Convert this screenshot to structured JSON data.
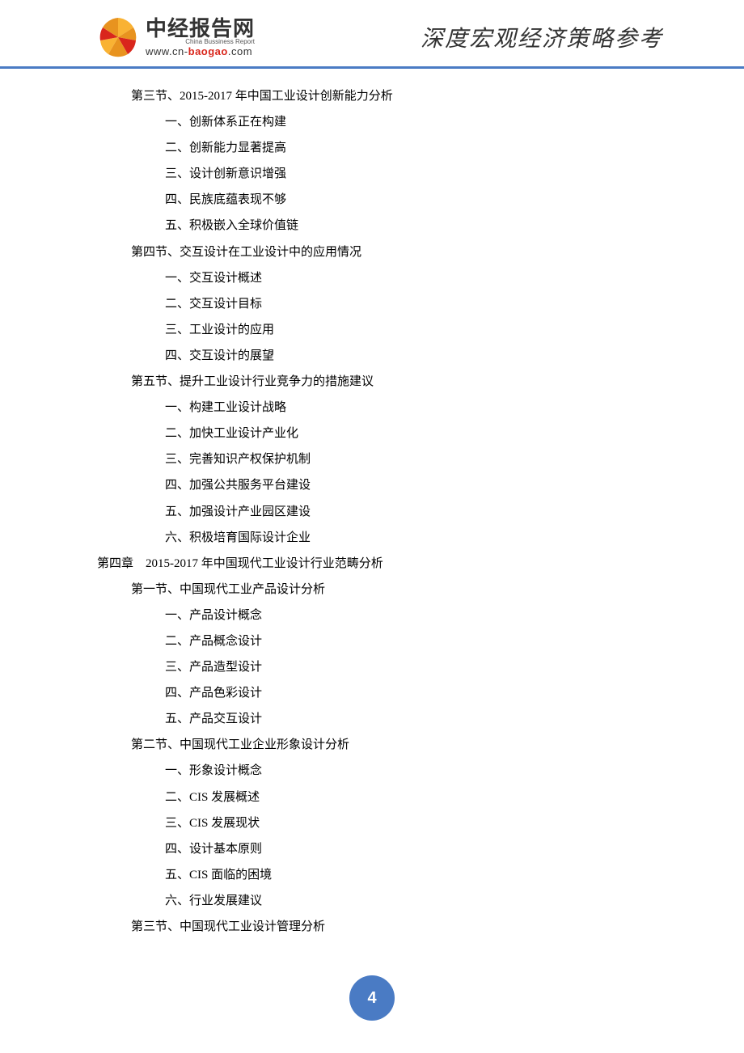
{
  "header": {
    "logo_title": "中经报告网",
    "logo_subtitle": "China Bussiness Report",
    "logo_url_prefix": "www.cn-",
    "logo_url_mid": "baogao",
    "logo_url_suffix": ".com",
    "slogan": "深度宏观经济策略参考"
  },
  "toc": [
    {
      "level": "section",
      "text": "第三节、2015-2017 年中国工业设计创新能力分析"
    },
    {
      "level": "item",
      "text": "一、创新体系正在构建"
    },
    {
      "level": "item",
      "text": "二、创新能力显著提高"
    },
    {
      "level": "item",
      "text": "三、设计创新意识增强"
    },
    {
      "level": "item",
      "text": "四、民族底蕴表现不够"
    },
    {
      "level": "item",
      "text": "五、积极嵌入全球价值链"
    },
    {
      "level": "section",
      "text": "第四节、交互设计在工业设计中的应用情况"
    },
    {
      "level": "item",
      "text": "一、交互设计概述"
    },
    {
      "level": "item",
      "text": "二、交互设计目标"
    },
    {
      "level": "item",
      "text": "三、工业设计的应用"
    },
    {
      "level": "item",
      "text": "四、交互设计的展望"
    },
    {
      "level": "section",
      "text": "第五节、提升工业设计行业竞争力的措施建议"
    },
    {
      "level": "item",
      "text": "一、构建工业设计战略"
    },
    {
      "level": "item",
      "text": "二、加快工业设计产业化"
    },
    {
      "level": "item",
      "text": "三、完善知识产权保护机制"
    },
    {
      "level": "item",
      "text": "四、加强公共服务平台建设"
    },
    {
      "level": "item",
      "text": "五、加强设计产业园区建设"
    },
    {
      "level": "item",
      "text": "六、积极培育国际设计企业"
    },
    {
      "level": "chapter",
      "text": "第四章　2015-2017 年中国现代工业设计行业范畴分析"
    },
    {
      "level": "section",
      "text": "第一节、中国现代工业产品设计分析"
    },
    {
      "level": "item",
      "text": "一、产品设计概念"
    },
    {
      "level": "item",
      "text": "二、产品概念设计"
    },
    {
      "level": "item",
      "text": "三、产品造型设计"
    },
    {
      "level": "item",
      "text": "四、产品色彩设计"
    },
    {
      "level": "item",
      "text": "五、产品交互设计"
    },
    {
      "level": "section",
      "text": "第二节、中国现代工业企业形象设计分析"
    },
    {
      "level": "item",
      "text": "一、形象设计概念"
    },
    {
      "level": "item",
      "text": "二、CIS 发展概述"
    },
    {
      "level": "item",
      "text": "三、CIS 发展现状"
    },
    {
      "level": "item",
      "text": "四、设计基本原则"
    },
    {
      "level": "item",
      "text": "五、CIS 面临的困境"
    },
    {
      "level": "item",
      "text": "六、行业发展建议"
    },
    {
      "level": "section",
      "text": "第三节、中国现代工业设计管理分析"
    }
  ],
  "page_number": "4"
}
